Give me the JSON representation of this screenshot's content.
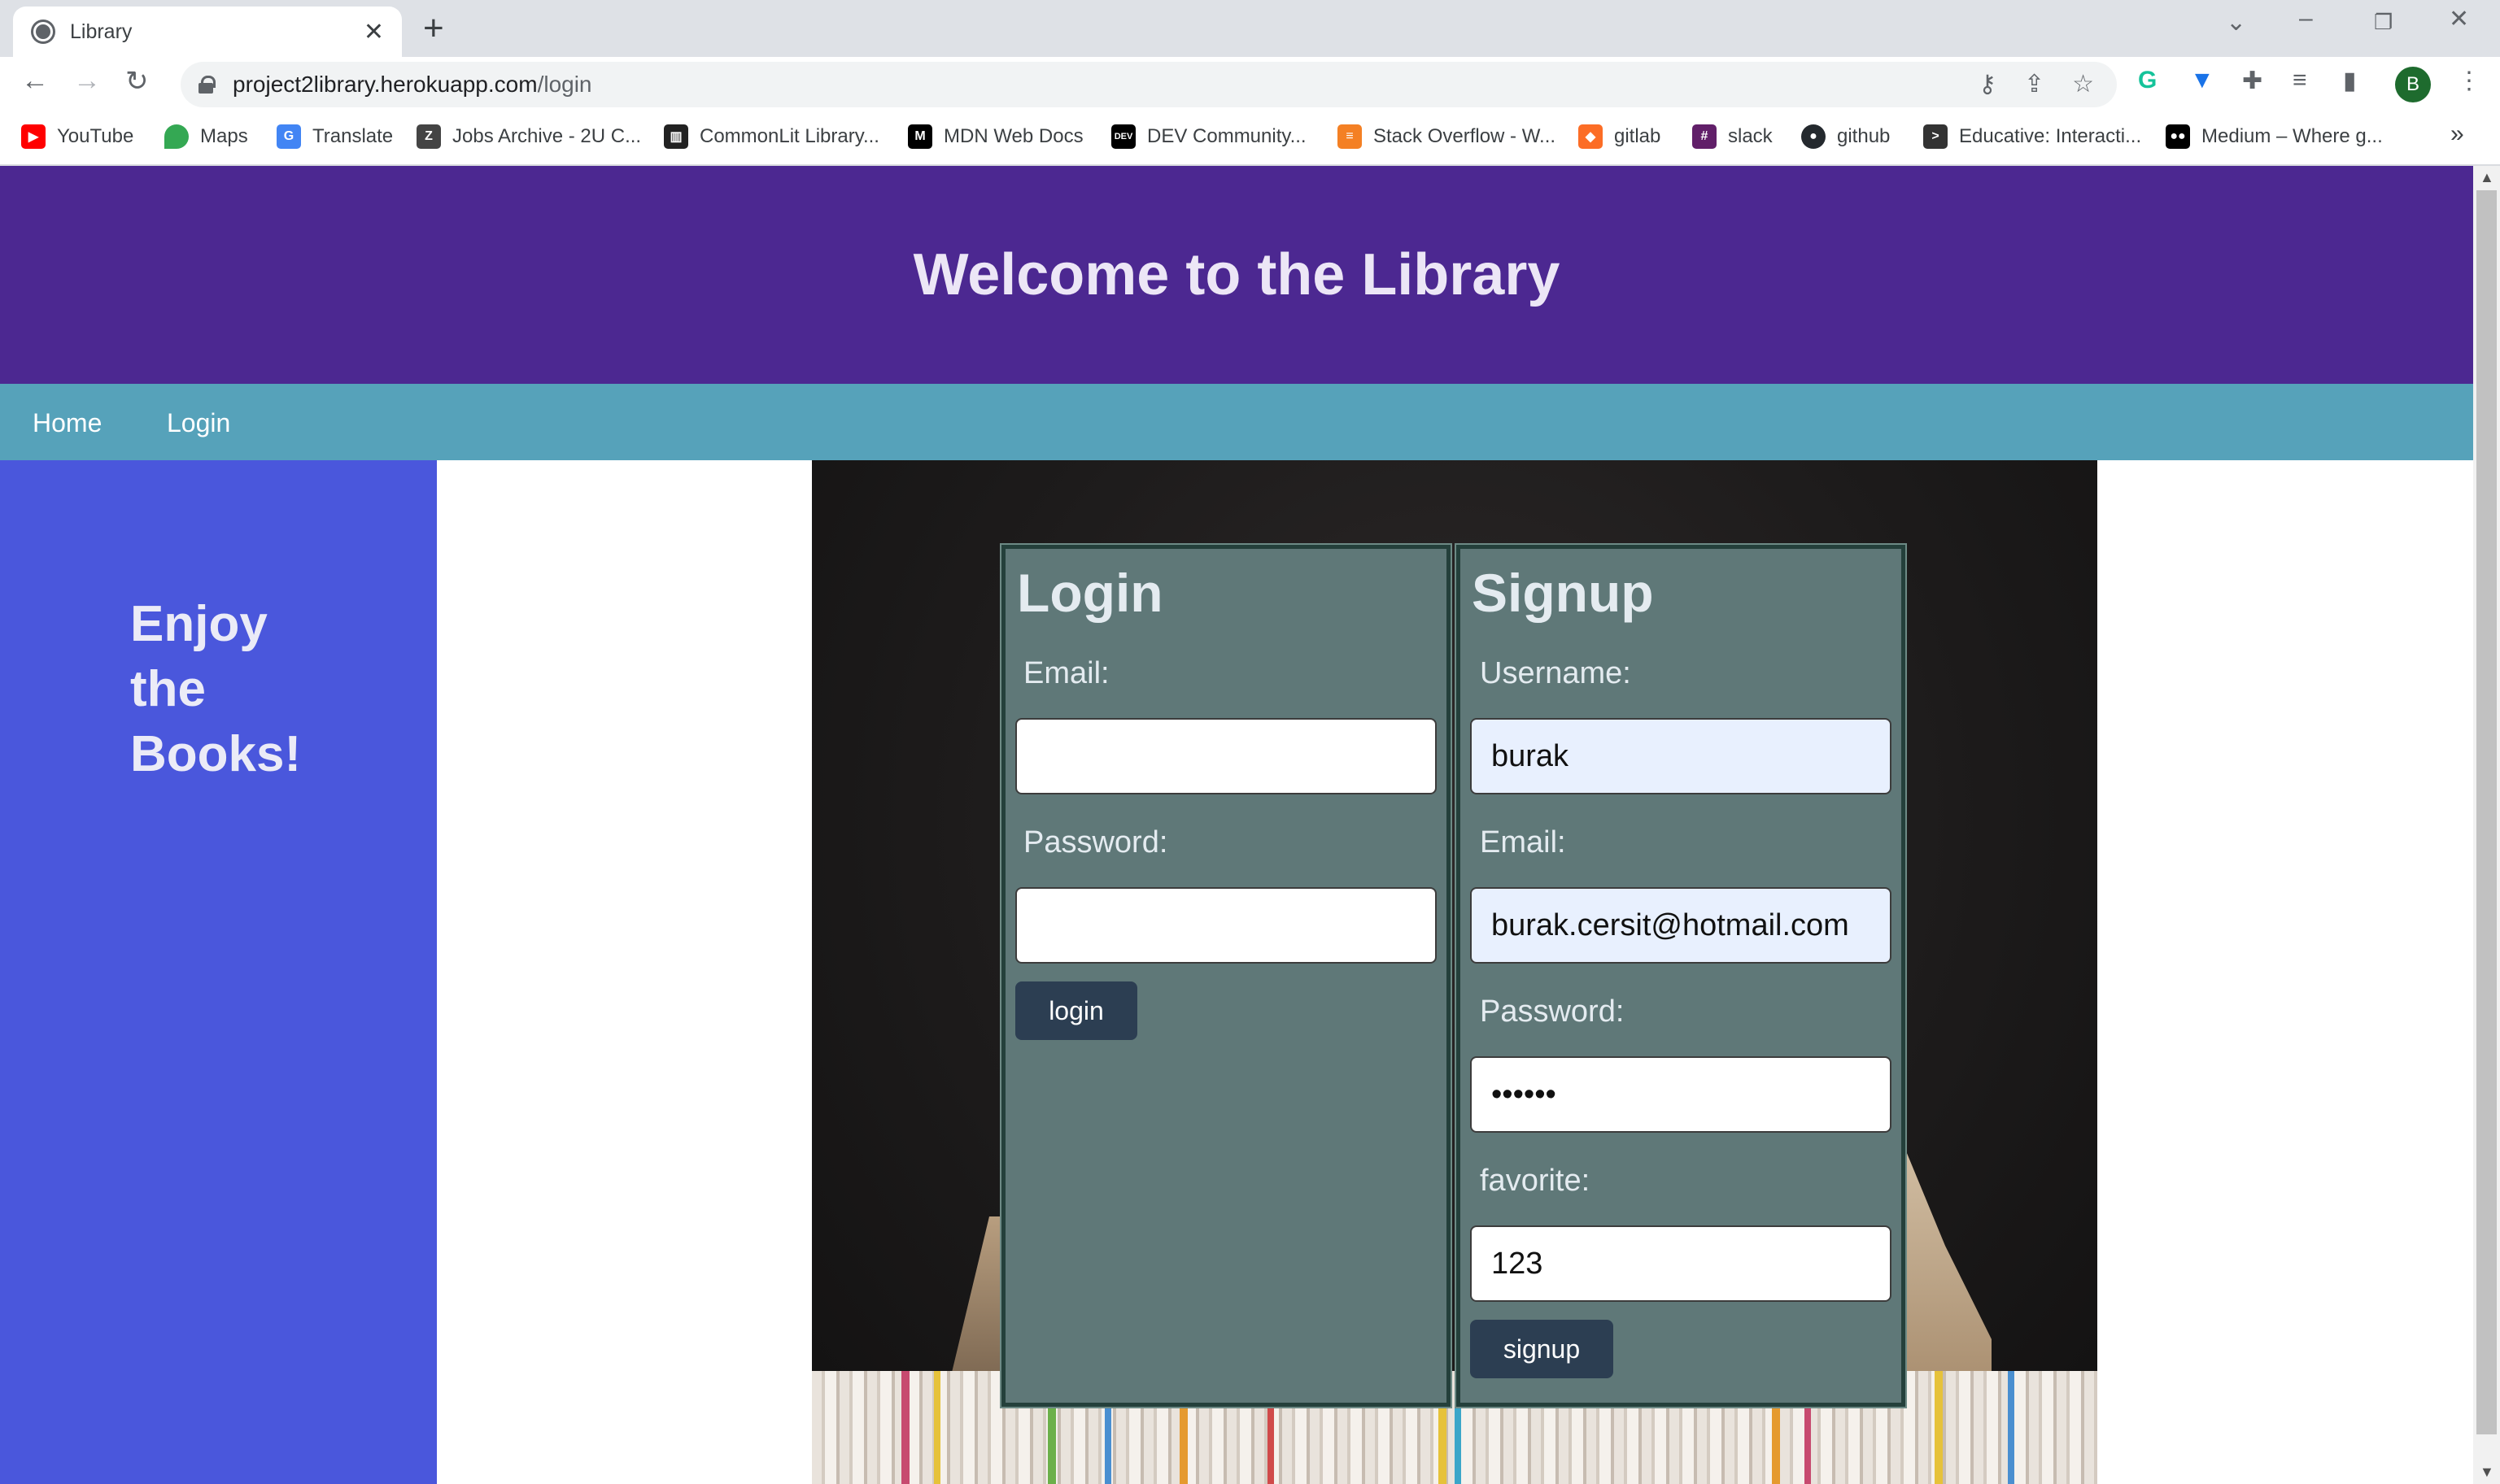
{
  "browser": {
    "tab_title": "Library",
    "url_host": "project2library.herokuapp.com",
    "url_path": "/login",
    "profile_initial": "B",
    "bookmarks": [
      {
        "label": "YouTube",
        "icon": "youtube-icon",
        "color": "#ff0000"
      },
      {
        "label": "Maps",
        "icon": "maps-icon",
        "color": "#34a853"
      },
      {
        "label": "Translate",
        "icon": "translate-icon",
        "color": "#4285f4"
      },
      {
        "label": "Jobs Archive - 2U C...",
        "icon": "jobs-icon",
        "color": "#444444"
      },
      {
        "label": "CommonLit Library...",
        "icon": "book-icon",
        "color": "#222222"
      },
      {
        "label": "MDN Web Docs",
        "icon": "mdn-icon",
        "color": "#000000"
      },
      {
        "label": "DEV Community...",
        "icon": "dev-icon",
        "color": "#000000"
      },
      {
        "label": "Stack Overflow - W...",
        "icon": "stackoverflow-icon",
        "color": "#f48024"
      },
      {
        "label": "gitlab",
        "icon": "gitlab-icon",
        "color": "#fc6d26"
      },
      {
        "label": "slack",
        "icon": "slack-icon",
        "color": "#611f69"
      },
      {
        "label": "github",
        "icon": "github-icon",
        "color": "#24292e"
      },
      {
        "label": "Educative: Interacti...",
        "icon": "educative-icon",
        "color": "#333333"
      },
      {
        "label": "Medium – Where g...",
        "icon": "medium-icon",
        "color": "#000000"
      }
    ]
  },
  "site": {
    "header_title": "Welcome to the Library",
    "nav": {
      "home": "Home",
      "login": "Login"
    },
    "sidebar_tagline": "Enjoy the Books!"
  },
  "login_form": {
    "title": "Login",
    "email_label": "Email:",
    "email_value": "",
    "password_label": "Password:",
    "password_value": "",
    "button_label": "login"
  },
  "signup_form": {
    "title": "Signup",
    "username_label": "Username:",
    "username_value": "burak",
    "email_label": "Email:",
    "email_value": "burak.cersit@hotmail.com",
    "password_label": "Password:",
    "password_value": "••••••",
    "favorite_label": "favorite:",
    "favorite_value": "123",
    "button_label": "signup"
  },
  "colors": {
    "header_bg": "#4c2891",
    "nav_bg": "#56a2ba",
    "sidebar_bg": "#4a57dc",
    "panel_bg": "#5f7878",
    "button_bg": "#2c3e52"
  }
}
